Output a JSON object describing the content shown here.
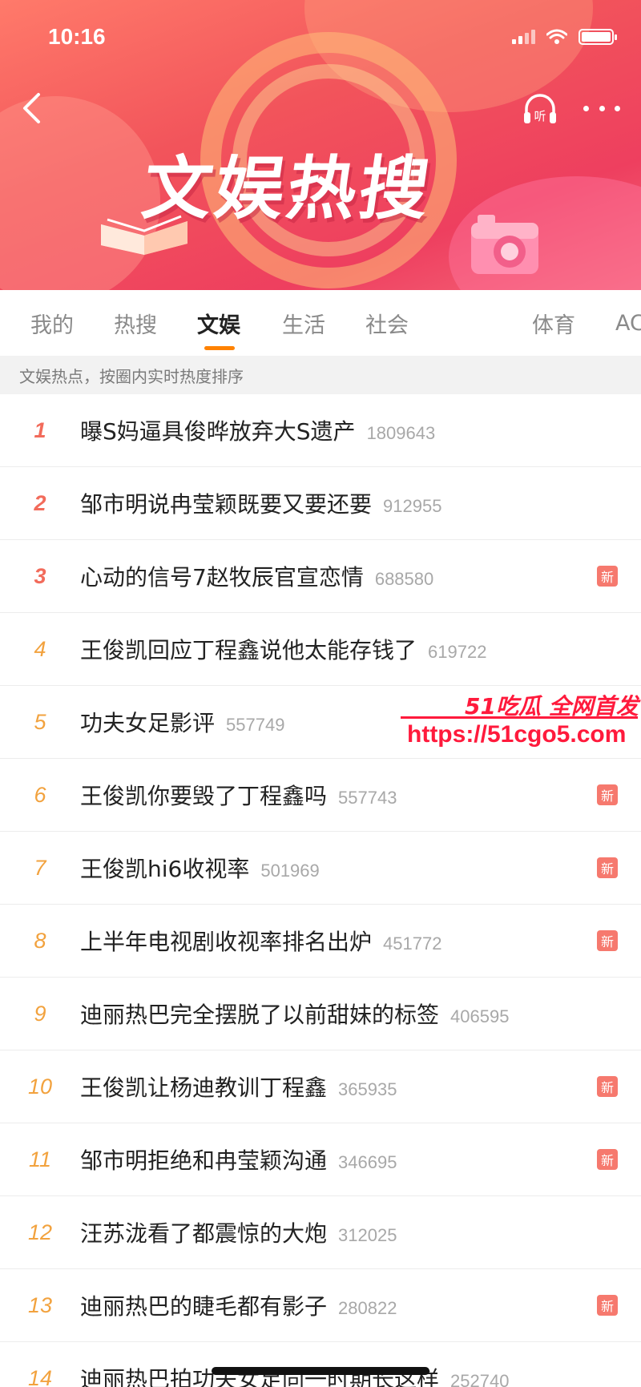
{
  "status_bar": {
    "time": "10:16"
  },
  "banner": {
    "title": "文娱热搜",
    "listen_label": "听"
  },
  "tabs": [
    "我的",
    "热搜",
    "文娱",
    "生活",
    "社会",
    "体育",
    "AC"
  ],
  "active_tab": "文娱",
  "subheader": "文娱热点，按圈内实时热度排序",
  "new_badge_label": "新",
  "items": [
    {
      "rank": "1",
      "title": "曝S妈逼具俊晔放弃大S遗产",
      "count": "1809643",
      "new": false
    },
    {
      "rank": "2",
      "title": "邹市明说冉莹颖既要又要还要",
      "count": "912955",
      "new": false
    },
    {
      "rank": "3",
      "title": "心动的信号7赵牧辰官宣恋情",
      "count": "688580",
      "new": true
    },
    {
      "rank": "4",
      "title": "王俊凯回应丁程鑫说他太能存钱了",
      "count": "619722",
      "new": false
    },
    {
      "rank": "5",
      "title": "功夫女足影评",
      "count": "557749",
      "new": false
    },
    {
      "rank": "6",
      "title": "王俊凯你要毁了丁程鑫吗",
      "count": "557743",
      "new": true
    },
    {
      "rank": "7",
      "title": "王俊凯hi6收视率",
      "count": "501969",
      "new": true
    },
    {
      "rank": "8",
      "title": "上半年电视剧收视率排名出炉",
      "count": "451772",
      "new": true
    },
    {
      "rank": "9",
      "title": "迪丽热巴完全摆脱了以前甜妹的标签",
      "count": "406595",
      "new": false
    },
    {
      "rank": "10",
      "title": "王俊凯让杨迪教训丁程鑫",
      "count": "365935",
      "new": true
    },
    {
      "rank": "11",
      "title": "邹市明拒绝和冉莹颖沟通",
      "count": "346695",
      "new": true
    },
    {
      "rank": "12",
      "title": "汪苏泷看了都震惊的大炮",
      "count": "312025",
      "new": false
    },
    {
      "rank": "13",
      "title": "迪丽热巴的睫毛都有影子",
      "count": "280822",
      "new": true
    },
    {
      "rank": "14",
      "title": "迪丽热巴拍功夫女足同一时期长这样",
      "count": "252740",
      "new": false
    }
  ],
  "watermark": {
    "top": "51吃瓜 全网首发",
    "url": "https://51cgo5.com"
  }
}
